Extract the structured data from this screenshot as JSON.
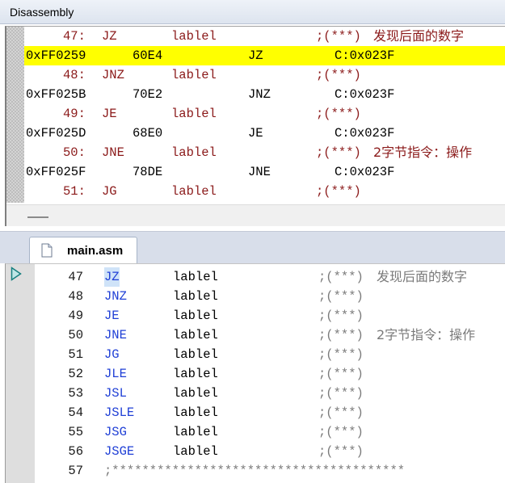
{
  "disassembly": {
    "title": "Disassembly",
    "lines": [
      {
        "kind": "src",
        "num": "47:",
        "op": "JZ",
        "arg": "lablel",
        "cmt": ";(***)",
        "note": "发现后面的数字"
      },
      {
        "kind": "asm",
        "addr": "0xFF0259",
        "code": "60E4",
        "mnem": "JZ",
        "target": "C:0x023F",
        "highlight": true
      },
      {
        "kind": "src",
        "num": "48:",
        "op": "JNZ",
        "arg": "lablel",
        "cmt": ";(***)",
        "note": ""
      },
      {
        "kind": "asm",
        "addr": "0xFF025B",
        "code": "70E2",
        "mnem": "JNZ",
        "target": "C:0x023F"
      },
      {
        "kind": "src",
        "num": "49:",
        "op": "JE",
        "arg": "lablel",
        "cmt": ";(***)",
        "note": ""
      },
      {
        "kind": "asm",
        "addr": "0xFF025D",
        "code": "68E0",
        "mnem": "JE",
        "target": "C:0x023F"
      },
      {
        "kind": "src",
        "num": "50:",
        "op": "JNE",
        "arg": "lablel",
        "cmt": ";(***)",
        "note": "2字节指令：操作"
      },
      {
        "kind": "asm",
        "addr": "0xFF025F",
        "code": "78DE",
        "mnem": "JNE",
        "target": "C:0x023F"
      },
      {
        "kind": "src",
        "num": "51:",
        "op": "JG",
        "arg": "lablel",
        "cmt": ";(***)",
        "note": ""
      }
    ]
  },
  "editor": {
    "tab_label": "main.asm",
    "lines": [
      {
        "num": "47",
        "ins": "JZ",
        "opr": "lablel",
        "cmt": ";(***)",
        "note": "发现后面的数字",
        "current": true
      },
      {
        "num": "48",
        "ins": "JNZ",
        "opr": "lablel",
        "cmt": ";(***)",
        "note": ""
      },
      {
        "num": "49",
        "ins": "JE",
        "opr": "lablel",
        "cmt": ";(***)",
        "note": ""
      },
      {
        "num": "50",
        "ins": "JNE",
        "opr": "lablel",
        "cmt": ";(***)",
        "note": "2字节指令：操作"
      },
      {
        "num": "51",
        "ins": "JG",
        "opr": "lablel",
        "cmt": ";(***)",
        "note": ""
      },
      {
        "num": "52",
        "ins": "JLE",
        "opr": "lablel",
        "cmt": ";(***)",
        "note": ""
      },
      {
        "num": "53",
        "ins": "JSL",
        "opr": "lablel",
        "cmt": ";(***)",
        "note": ""
      },
      {
        "num": "54",
        "ins": "JSLE",
        "opr": "lablel",
        "cmt": ";(***)",
        "note": ""
      },
      {
        "num": "55",
        "ins": "JSG",
        "opr": "lablel",
        "cmt": ";(***)",
        "note": ""
      },
      {
        "num": "56",
        "ins": "JSGE",
        "opr": "lablel",
        "cmt": ";(***)",
        "note": ""
      },
      {
        "num": "57",
        "ins": ";***************************************",
        "opr": "",
        "cmt": "",
        "note": "",
        "comment_line": true
      }
    ]
  },
  "icons": {
    "tab_file": "file-icon",
    "exec_pointer": "current-line-arrow-icon"
  },
  "colors": {
    "highlight": "#ffff00",
    "keyword": "#1f3fd6",
    "source_line": "#8b1a1a",
    "comment": "#7a7a7a"
  }
}
